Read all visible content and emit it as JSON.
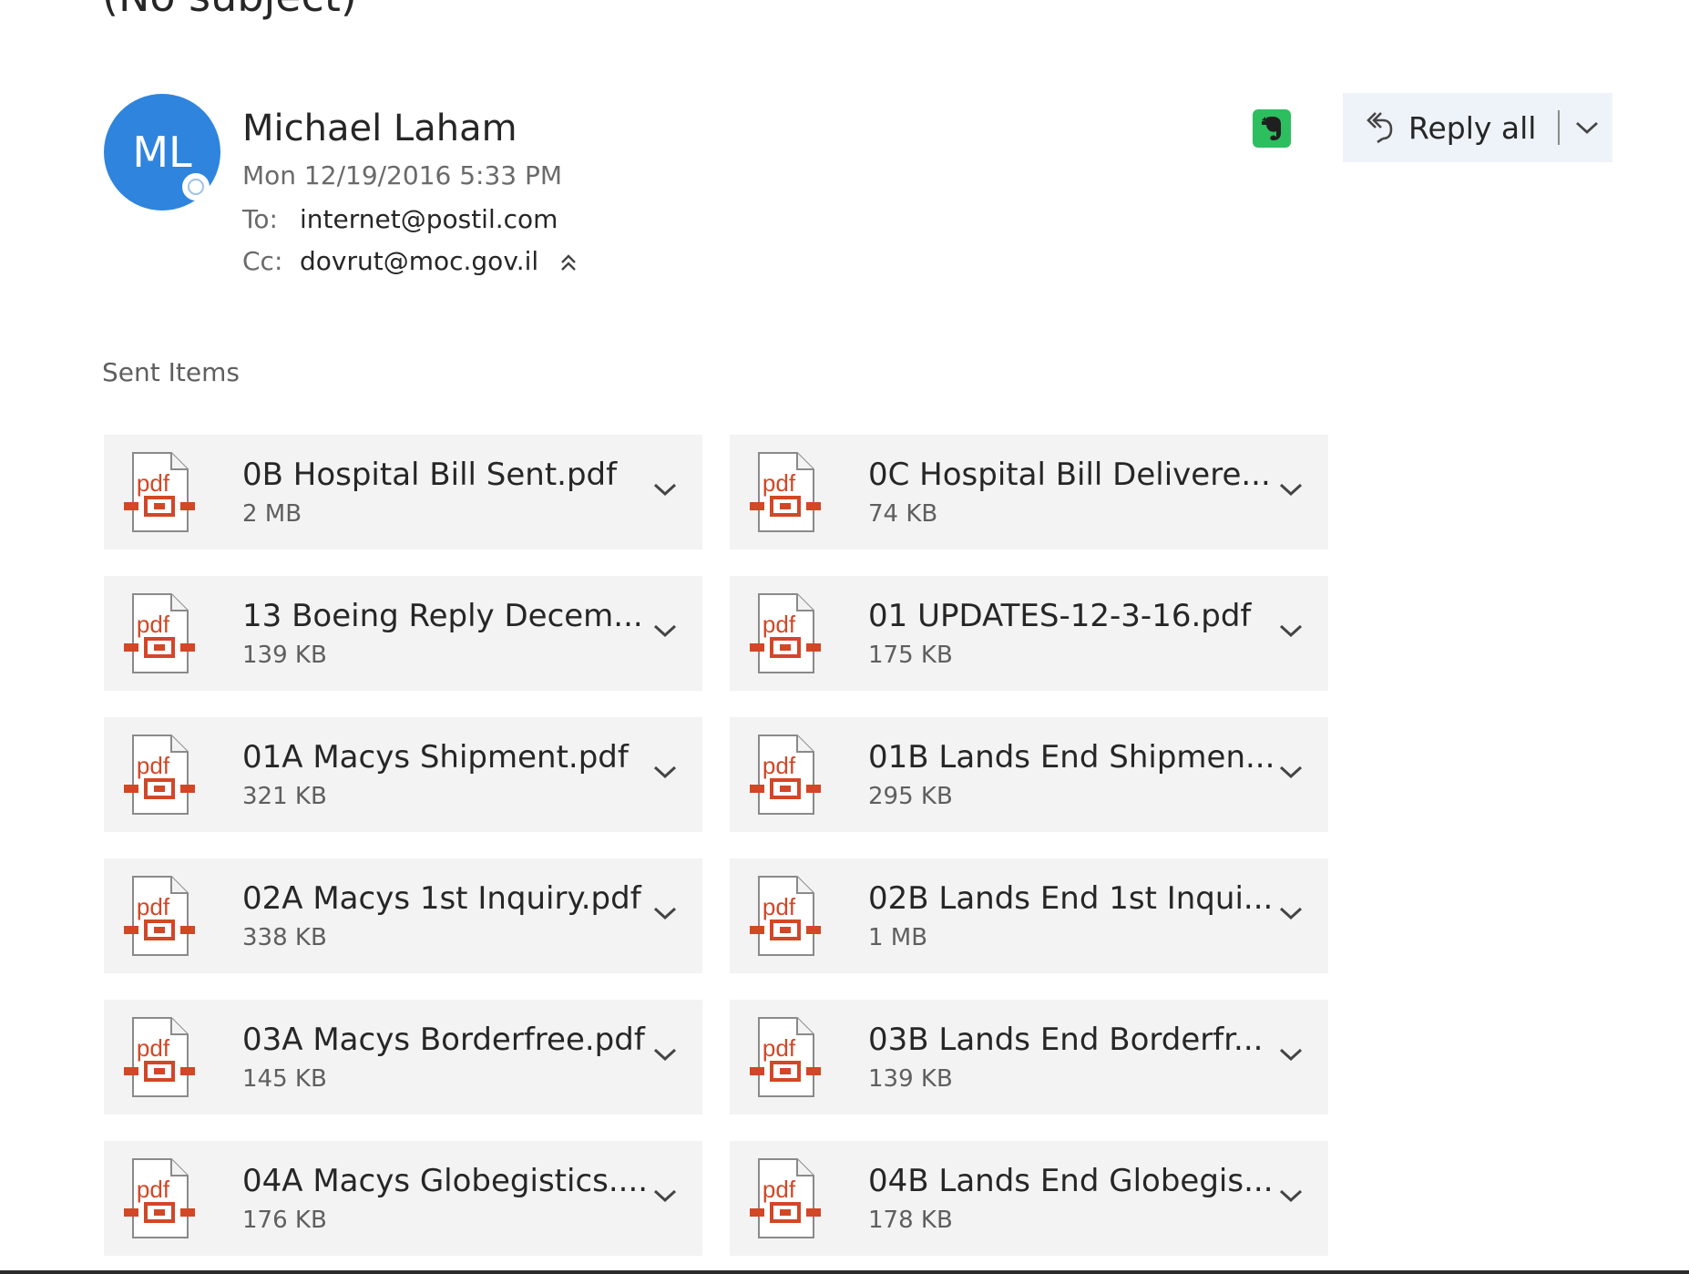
{
  "message": {
    "subject": "(No subject)",
    "sender": {
      "initials": "ML",
      "name": "Michael Laham"
    },
    "sent": "Mon 12/19/2016 5:33 PM",
    "to_label": "To:",
    "to": "internet@postil.com",
    "cc_label": "Cc:",
    "cc": "dovrut@moc.gov.il",
    "folder": "Sent Items"
  },
  "toolbar": {
    "reply_all_label": "Reply all",
    "evernote_icon": "evernote-icon",
    "reply_icon": "reply-all-icon"
  },
  "colors": {
    "avatar": "#2f84dd",
    "evernote": "#2dbe60",
    "pdf": "#d24726",
    "button_bg": "#eef3f9",
    "attachment_bg": "#f3f3f3"
  },
  "attachments": [
    {
      "name": "0B Hospital Bill Sent.pdf",
      "size": "2 MB",
      "icon": "pdf-icon"
    },
    {
      "name": "0C Hospital Bill Delivere...",
      "size": "74 KB",
      "icon": "pdf-icon"
    },
    {
      "name": "13 Boeing Reply Decem...",
      "size": "139 KB",
      "icon": "pdf-icon"
    },
    {
      "name": "01 UPDATES-12-3-16.pdf",
      "size": "175 KB",
      "icon": "pdf-icon"
    },
    {
      "name": "01A Macys Shipment.pdf",
      "size": "321 KB",
      "icon": "pdf-icon"
    },
    {
      "name": "01B Lands End Shipmen...",
      "size": "295 KB",
      "icon": "pdf-icon"
    },
    {
      "name": "02A Macys 1st Inquiry.pdf",
      "size": "338 KB",
      "icon": "pdf-icon"
    },
    {
      "name": "02B Lands End 1st Inqui...",
      "size": "1 MB",
      "icon": "pdf-icon"
    },
    {
      "name": "03A Macys Borderfree.pdf",
      "size": "145 KB",
      "icon": "pdf-icon"
    },
    {
      "name": "03B Lands End Borderfr...",
      "size": "139 KB",
      "icon": "pdf-icon"
    },
    {
      "name": "04A Macys Globegistics....",
      "size": "176 KB",
      "icon": "pdf-icon"
    },
    {
      "name": "04B Lands End Globegis...",
      "size": "178 KB",
      "icon": "pdf-icon"
    }
  ]
}
